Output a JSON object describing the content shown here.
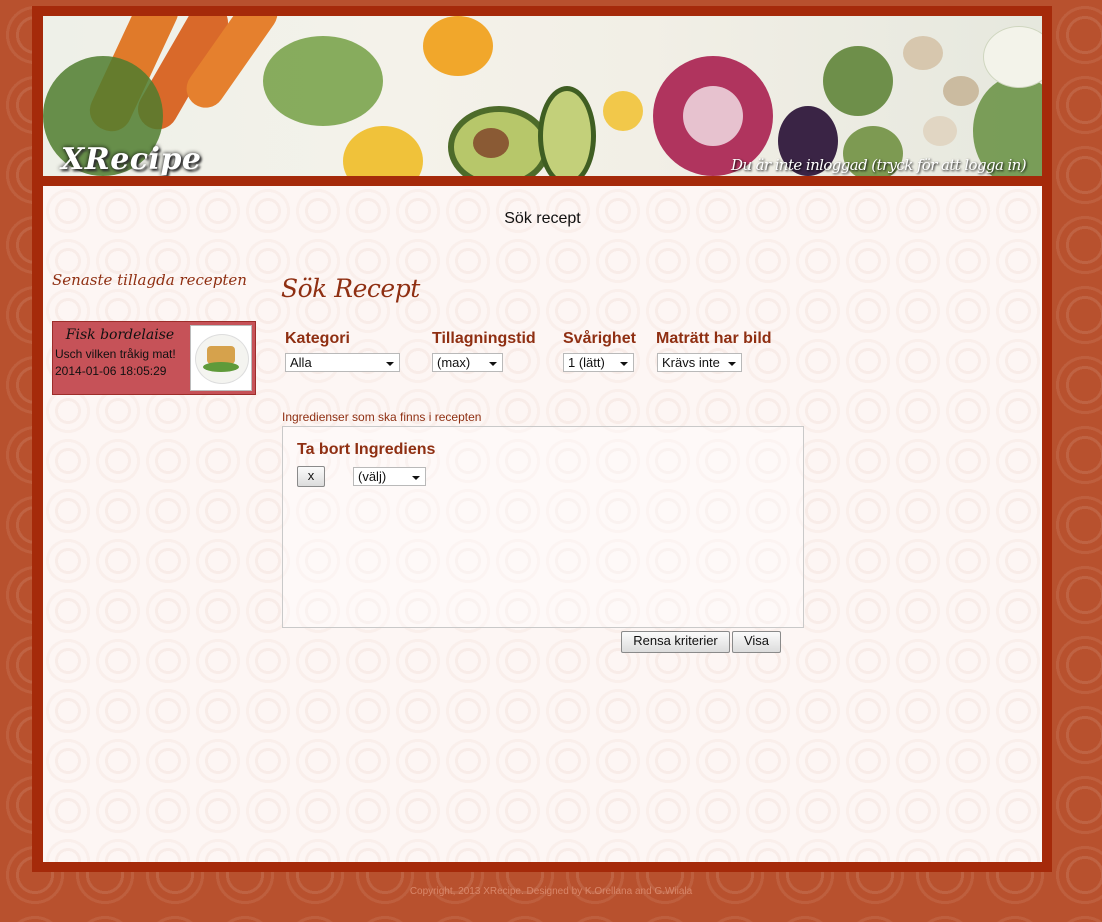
{
  "header": {
    "logo": "XRecipe",
    "login_status": "Du är inte inloggad (tryck för att logga in)"
  },
  "main": {
    "page_heading": "Sök recept",
    "search_title": "Sök Recept"
  },
  "sidebar": {
    "title": "Senaste tillagda recepten",
    "latest": {
      "name": "Fisk bordelaise",
      "description": "Usch vilken tråkig mat!",
      "date": "2014-01-06 18:05:29"
    }
  },
  "filters": {
    "category": {
      "label": "Kategori",
      "value": "Alla"
    },
    "cook_time": {
      "label": "Tillagningstid",
      "value": "(max)"
    },
    "difficulty": {
      "label": "Svårighet",
      "value": "1 (lätt)"
    },
    "has_image": {
      "label": "Maträtt har bild",
      "value": "Krävs inte"
    }
  },
  "ingredients": {
    "caption": "Ingredienser som ska finns i recepten",
    "remove_label": "Ta bort Ingrediens",
    "remove_button": "x",
    "select_value": "(välj)"
  },
  "actions": {
    "clear_label": "Rensa kriterier",
    "show_label": "Visa"
  },
  "footer": {
    "text": "Copyright, 2013 XRecipe. Designed by K.Orellana and G.Wiiala"
  },
  "colors": {
    "brand_dark": "#a52a0a",
    "heading": "#8f2f12",
    "card": "#c65258",
    "background": "#b8512e"
  }
}
